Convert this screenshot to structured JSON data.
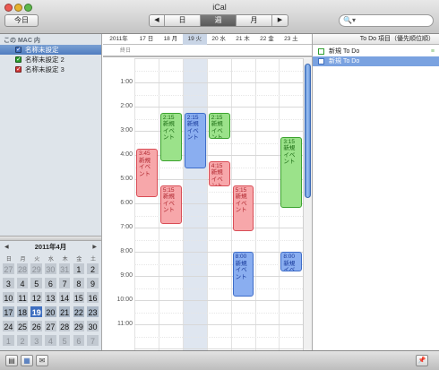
{
  "window": {
    "title": "iCal"
  },
  "toolbar": {
    "today_label": "今日",
    "prev_glyph": "◀",
    "next_glyph": "▶",
    "view_day": "日",
    "view_week": "週",
    "view_month": "月",
    "search_glyph": "🔍▾",
    "search_placeholder": ""
  },
  "sidebar": {
    "section_label": "この MAC 内",
    "calendars": [
      {
        "label": "名称未設定",
        "color": "#3f6fc0",
        "checked": true,
        "selected": true
      },
      {
        "label": "名称未設定 2",
        "color": "#2e9e2e",
        "checked": true,
        "selected": false
      },
      {
        "label": "名称未設定 3",
        "color": "#d23a3a",
        "checked": true,
        "selected": false
      }
    ]
  },
  "mini_calendar": {
    "prev_glyph": "◀",
    "title": "2011年4月",
    "next_glyph": "▶",
    "weekdays": [
      "日",
      "月",
      "火",
      "水",
      "木",
      "金",
      "土"
    ],
    "weeks": [
      [
        "27",
        "28",
        "29",
        "30",
        "31",
        "1",
        "2"
      ],
      [
        "3",
        "4",
        "5",
        "6",
        "7",
        "8",
        "9"
      ],
      [
        "10",
        "11",
        "12",
        "13",
        "14",
        "15",
        "16"
      ],
      [
        "17",
        "18",
        "19",
        "20",
        "21",
        "22",
        "23"
      ],
      [
        "24",
        "25",
        "26",
        "27",
        "28",
        "29",
        "30"
      ],
      [
        "1",
        "2",
        "3",
        "4",
        "5",
        "6",
        "7"
      ]
    ],
    "today": "19"
  },
  "week_view": {
    "year_label": "2011年",
    "days": [
      "17 日",
      "18 月",
      "19 火",
      "20 水",
      "21 木",
      "22 金",
      "23 土"
    ],
    "allday_label": "終日",
    "hours": [
      "1:00",
      "2:00",
      "3:00",
      "4:00",
      "5:00",
      "6:00",
      "7:00",
      "8:00",
      "9:00",
      "10:00",
      "11:00"
    ],
    "events": [
      {
        "day": 1,
        "start": 3.75,
        "end": 5.75,
        "color": "red",
        "time": "3:45",
        "title": "新規イベント"
      },
      {
        "day": 2,
        "start": 2.25,
        "end": 4.25,
        "color": "green",
        "time": "2:15",
        "title": "新規イベント"
      },
      {
        "day": 2,
        "start": 5.25,
        "end": 6.85,
        "color": "red",
        "time": "5:15",
        "title": "新規イベント"
      },
      {
        "day": 3,
        "start": 2.25,
        "end": 4.55,
        "color": "blue",
        "time": "2:15",
        "title": "新規イベント"
      },
      {
        "day": 4,
        "start": 2.25,
        "end": 3.35,
        "color": "green",
        "time": "2:15",
        "title": "新規イベント"
      },
      {
        "day": 4,
        "start": 4.25,
        "end": 5.3,
        "color": "red",
        "time": "4:15",
        "title": "新規イベント"
      },
      {
        "day": 5,
        "start": 5.25,
        "end": 7.15,
        "color": "red",
        "time": "5:15",
        "title": "新規イベント"
      },
      {
        "day": 5,
        "start": 8.0,
        "end": 9.85,
        "color": "blue",
        "time": "8:00",
        "title": "新規イベント"
      },
      {
        "day": 7,
        "start": 3.25,
        "end": 6.2,
        "color": "green",
        "time": "3:15",
        "title": "新規イベント"
      },
      {
        "day": 7,
        "start": 8.0,
        "end": 8.8,
        "color": "blue",
        "time": "8:00",
        "title": "新規イベント"
      }
    ]
  },
  "todo": {
    "header": "To Do 項目（優先順位順）",
    "items": [
      {
        "label": "新規 To Do",
        "color": "#2e9e2e",
        "selected": false,
        "priority": "≡"
      },
      {
        "label": "新規 To Do",
        "color": "#3f6fc0",
        "selected": true,
        "priority": ""
      }
    ]
  },
  "bottom_bar": {
    "add_calendar_icon": "▤",
    "mini_month_icon": "▦",
    "notifications_icon": "✉",
    "todo_toggle_icon": "📌"
  }
}
